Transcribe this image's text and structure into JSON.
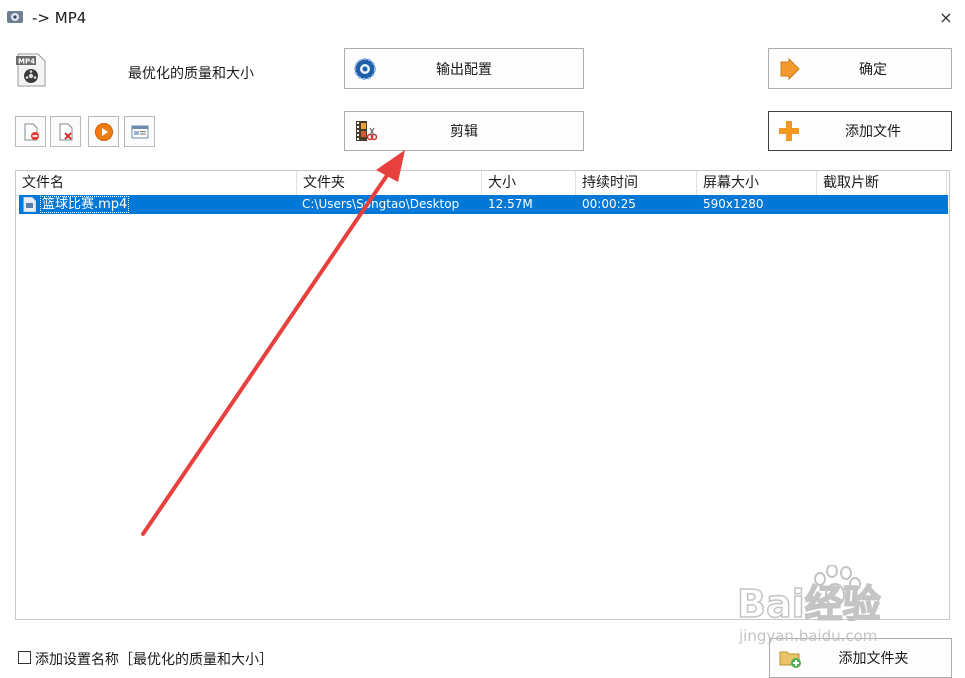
{
  "window": {
    "title": "-> MP4",
    "close_glyph": "×"
  },
  "preset": {
    "label": "最优化的质量和大小",
    "icon": "mp4-file-icon"
  },
  "buttons": {
    "output_config": {
      "label": "输出配置",
      "icon": "gear-icon"
    },
    "trim": {
      "label": "剪辑",
      "icon": "film-scissors-icon"
    },
    "ok": {
      "label": "确定",
      "icon": "arrow-right-icon"
    },
    "add_file": {
      "label": "添加文件",
      "icon": "plus-icon"
    },
    "add_folder": {
      "label": "添加文件夹",
      "icon": "folder-add-icon"
    }
  },
  "toolbar": [
    "remove-file-icon",
    "clear-list-icon",
    "play-icon",
    "file-info-icon"
  ],
  "list": {
    "columns": [
      "文件名",
      "文件夹",
      "大小",
      "持续时间",
      "屏幕大小",
      "截取片断"
    ],
    "rows": [
      {
        "name": "篮球比赛.mp4",
        "folder": "C:\\Users\\Songtao\\Desktop",
        "size": "12.57M",
        "duration": "00:00:25",
        "screen": "590x1280",
        "clip": ""
      }
    ]
  },
  "footer": {
    "checkbox_label": "添加设置名称［最优化的质量和大小］",
    "checked": false
  },
  "watermark": {
    "brand_text": "Bai经验",
    "domain_text": "jingyan.baidu.com"
  },
  "colors": {
    "selection": "#0078d7",
    "annotation_arrow": "#e8403d",
    "plus": "#f39a1e"
  }
}
